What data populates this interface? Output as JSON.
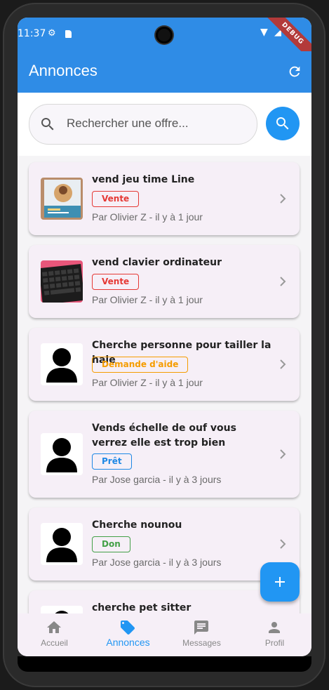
{
  "status_bar": {
    "time": "11:37",
    "debug_label": "DEBUG"
  },
  "app_bar": {
    "title": "Annonces"
  },
  "search": {
    "placeholder": "Rechercher une offre..."
  },
  "listings": [
    {
      "title": "vend jeu time Line",
      "badge": "Vente",
      "badge_color": "#e53935",
      "meta": "Par Olivier Z - il y à 1 jour",
      "thumb": "photo-game-box"
    },
    {
      "title": "vend clavier ordinateur",
      "badge": "Vente",
      "badge_color": "#e53935",
      "meta": "Par Olivier Z - il y à 1 jour",
      "thumb": "photo-keyboard"
    },
    {
      "title": "Cherche personne pour tailler la haie",
      "badge": "Demande d'aide",
      "badge_color": "#f59c00",
      "meta": "Par Olivier Z - il y à 1 jour",
      "thumb": "person-icon"
    },
    {
      "title": "Vends échelle de ouf vous verrez elle est trop bien",
      "badge": "Prêt",
      "badge_color": "#1e88e5",
      "meta": "Par Jose garcia - il y à 3 jours",
      "thumb": "person-icon"
    },
    {
      "title": "Cherche nounou",
      "badge": "Don",
      "badge_color": "#43a047",
      "meta": "Par Jose garcia - il y à 3 jours",
      "thumb": "person-icon"
    },
    {
      "title": "cherche pet sitter",
      "thumb": "person-icon"
    }
  ],
  "nav": [
    {
      "label": "Accueil",
      "icon": "home-icon"
    },
    {
      "label": "Annonces",
      "icon": "tag-icon",
      "active": true
    },
    {
      "label": "Messages",
      "icon": "message-icon"
    },
    {
      "label": "Profil",
      "icon": "person-icon"
    }
  ],
  "colors": {
    "primary": "#2f8ce6",
    "accent": "#2196f3",
    "card_bg": "#f6eff7"
  }
}
